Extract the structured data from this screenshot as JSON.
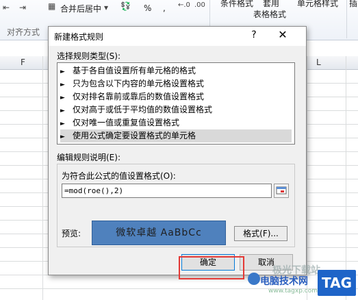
{
  "ribbon": {
    "merge_center": "合并后居中",
    "percent": "%",
    "comma": ",",
    "align_group": "对齐方式",
    "cond_format": "条件格式",
    "table_format_top": "套用",
    "table_format": "表格格式",
    "cell_styles": "单元格样式",
    "insert": "插"
  },
  "sheet": {
    "col_f": "F",
    "col_l": "L"
  },
  "dialog": {
    "title": "新建格式规则",
    "help": "?",
    "close": "✕",
    "select_type_label": "选择规则类型(S):",
    "rule_types": [
      "基于各自值设置所有单元格的格式",
      "只为包含以下内容的单元格设置格式",
      "仅对排名靠前或靠后的数值设置格式",
      "仅对高于或低于平均值的数值设置格式",
      "仅对唯一值或重复值设置格式",
      "使用公式确定要设置格式的单元格"
    ],
    "selected_index": 5,
    "edit_desc_label": "编辑规则说明(E):",
    "formula_label": "为符合此公式的值设置格式(O):",
    "formula_value": "=mod(roe(),2)",
    "preview_label": "预览:",
    "preview_text": "微软卓越  AaBbCc",
    "format_button": "格式(F)...",
    "ok_button": "确定",
    "cancel_button": "取消"
  },
  "watermark": {
    "line1": "极光下载站",
    "line2": "电脑技术网",
    "url": "www.tagxp.com",
    "tag": "TAG"
  },
  "colors": {
    "preview_fill": "#4f81bd",
    "highlight": "#e53935"
  }
}
